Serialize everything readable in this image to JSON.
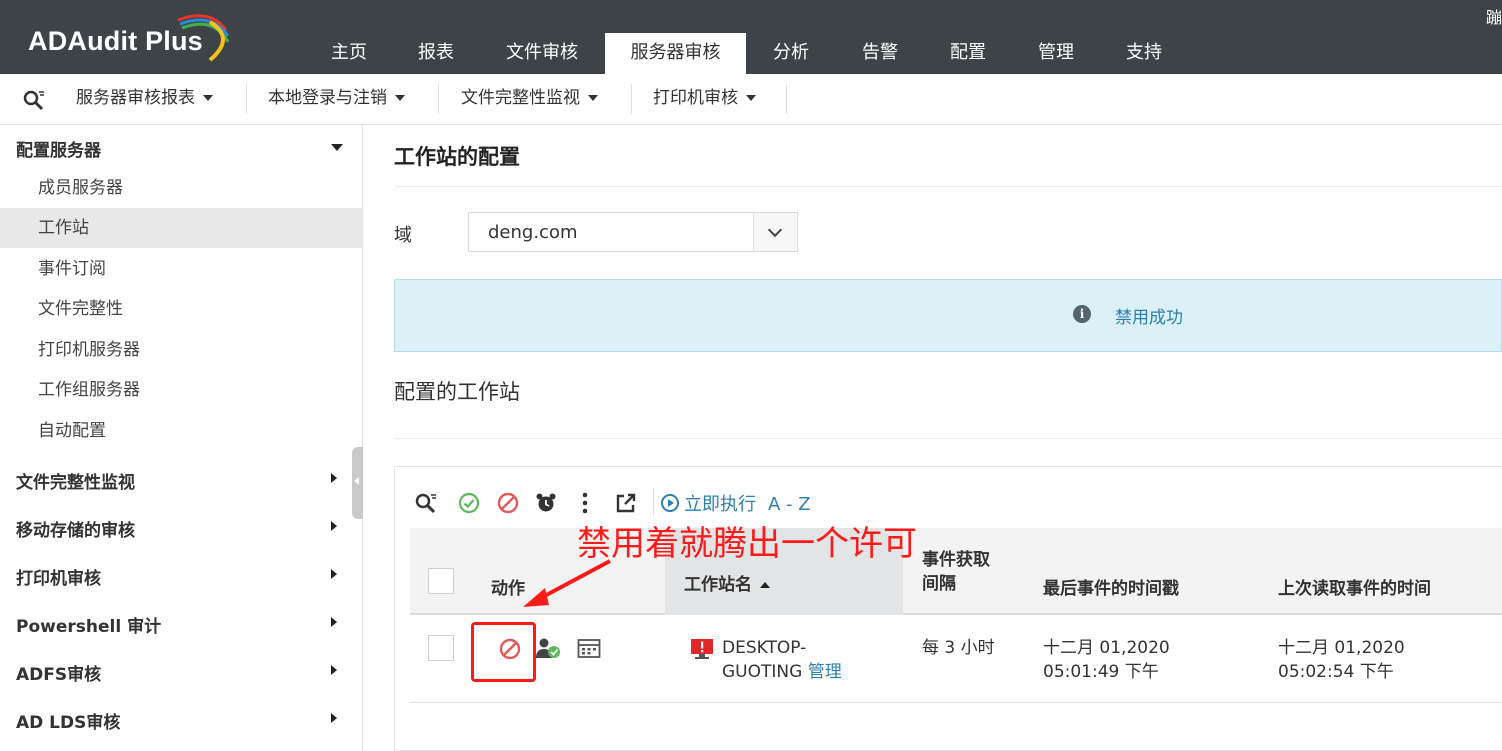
{
  "app": {
    "logo_text": "ADAudit Plus",
    "corner_char": "蹦"
  },
  "nav": {
    "tabs": [
      "主页",
      "报表",
      "文件审核",
      "服务器审核",
      "分析",
      "告警",
      "配置",
      "管理",
      "支持"
    ],
    "active_tab": "服务器审核"
  },
  "subnav": {
    "items": [
      "服务器审核报表",
      "本地登录与注销",
      "文件完整性监视",
      "打印机审核"
    ]
  },
  "sidebar": {
    "section_open": "配置服务器",
    "sub_items": [
      "成员服务器",
      "工作站",
      "事件订阅",
      "文件完整性",
      "打印机服务器",
      "工作组服务器",
      "自动配置"
    ],
    "active_sub": "工作站",
    "sections": [
      "文件完整性监视",
      "移动存储的审核",
      "打印机审核",
      "Powershell 审计",
      "ADFS审核",
      "AD LDS审核"
    ]
  },
  "main": {
    "title": "工作站的配置",
    "domain_label": "域",
    "domain_value": "deng.com",
    "info_message": "禁用成功",
    "section_title": "配置的工作站",
    "run_now": "立即执行",
    "sort_az": "A - Z"
  },
  "table": {
    "headers": {
      "action": "动作",
      "name": "工作站名",
      "interval_line1": "事件获取",
      "interval_line2": "间隔",
      "last_event": "最后事件的时间戳",
      "last_read": "上次读取事件的时间"
    },
    "rows": [
      {
        "name_line1": "DESKTOP-",
        "name_line2": "GUOTING",
        "manage": "管理",
        "interval": "每 3 小时",
        "last_event_date": "十二月 01,2020",
        "last_event_time": "05:01:49 下午",
        "last_read_date": "十二月 01,2020",
        "last_read_time": "05:02:54 下午"
      }
    ]
  },
  "annotation": {
    "text": "禁用着就腾出一个许可",
    "color": "#ff1a1a"
  },
  "colors": {
    "header_bg": "#3e4348",
    "link": "#2d7fae",
    "info_bg": "#dcf0f8",
    "enable_green": "#5cb85c",
    "disable_red": "#e05b5b"
  }
}
